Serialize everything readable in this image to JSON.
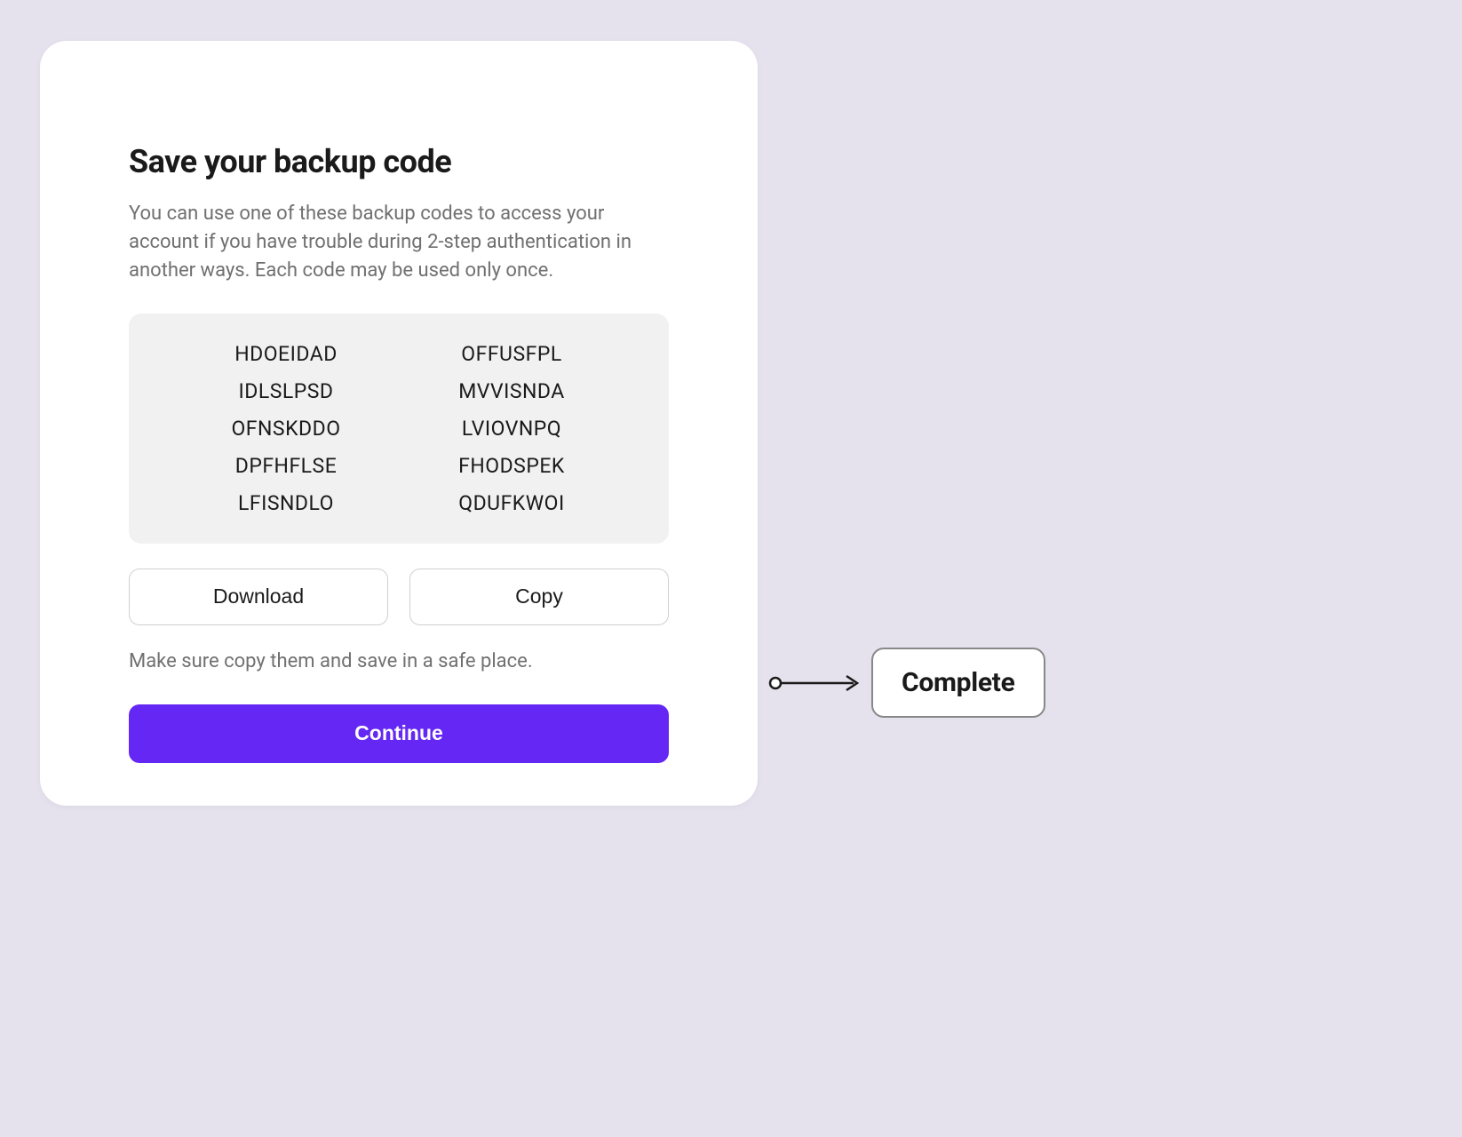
{
  "card": {
    "title": "Save your backup code",
    "description": "You can use one of these backup codes to access your account if you have trouble during 2-step authentication in another ways. Each code may be used only once.",
    "codes_left": [
      "HDOEIDAD",
      "IDLSLPSD",
      "OFNSKDDO",
      "DPFHFLSE",
      "LFISNDLO"
    ],
    "codes_right": [
      "OFFUSFPL",
      "MVVISNDA",
      "LVIOVNPQ",
      "FHODSPEK",
      "QDUFKWOI"
    ],
    "download_label": "Download",
    "copy_label": "Copy",
    "hint": "Make sure copy them and save in a safe place.",
    "continue_label": "Continue"
  },
  "annotation": {
    "complete_label": "Complete"
  }
}
